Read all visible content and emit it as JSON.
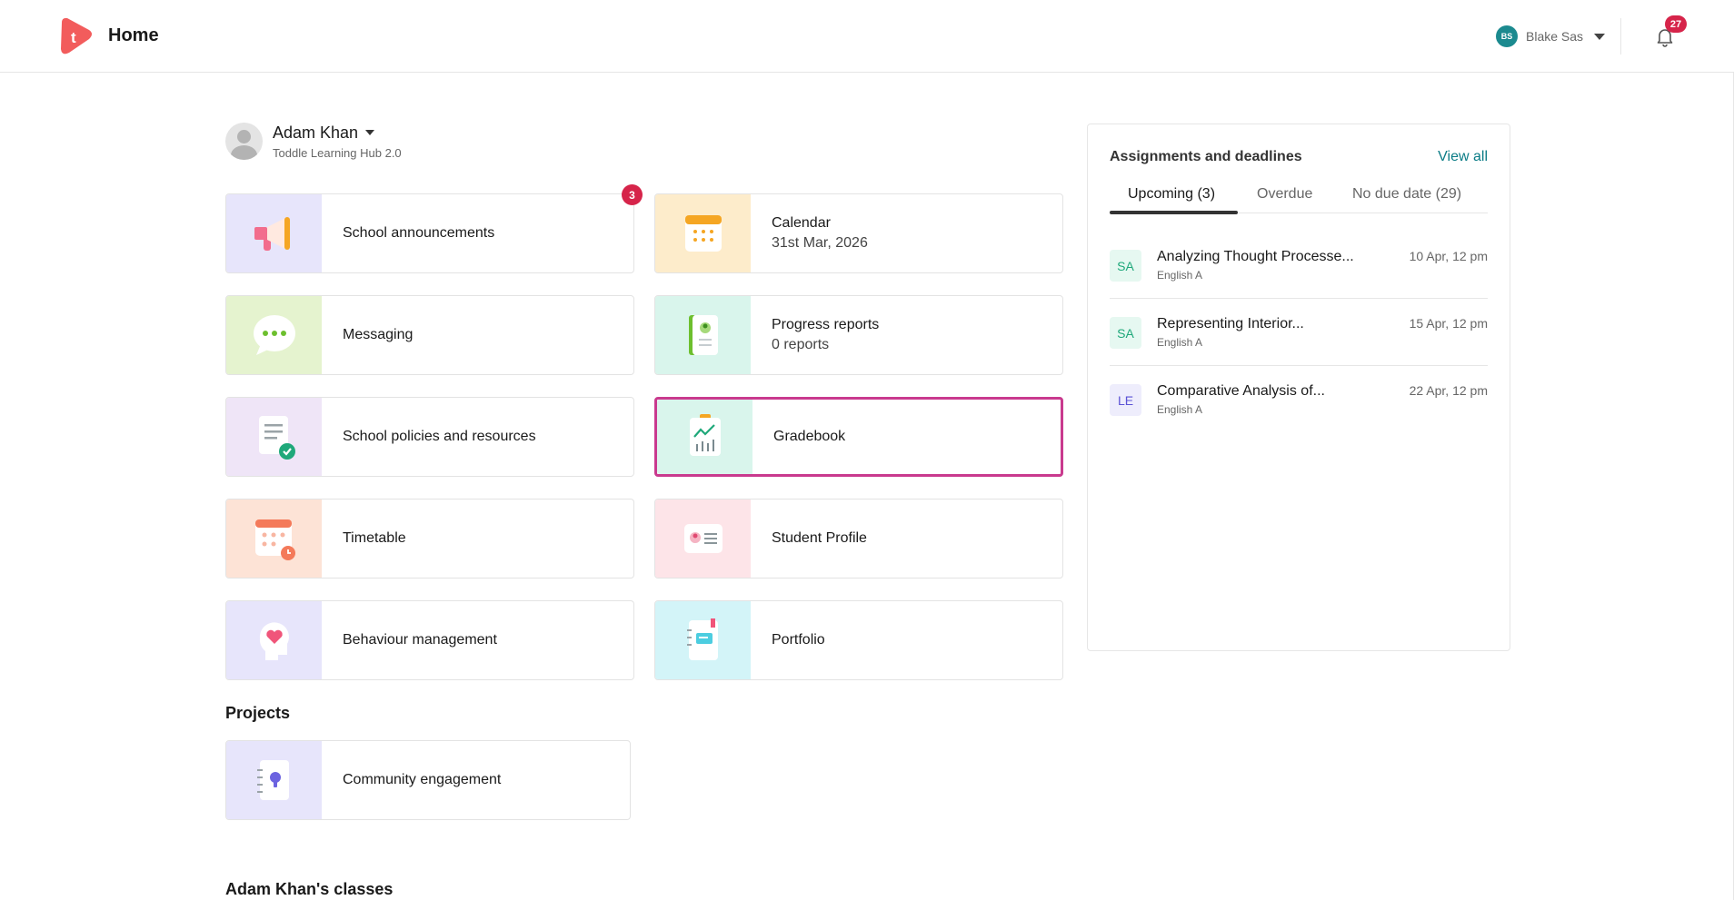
{
  "header": {
    "title": "Home",
    "user": {
      "initials": "BS",
      "name": "Blake Sas"
    },
    "notifications_count": "27"
  },
  "profile": {
    "name": "Adam Khan",
    "subtitle": "Toddle Learning Hub 2.0"
  },
  "tiles": [
    {
      "key": "announcements",
      "title": "School announcements",
      "subtitle": "",
      "icon": "megaphone-icon",
      "badge": "3"
    },
    {
      "key": "calendar",
      "title": "Calendar",
      "subtitle": "31st Mar, 2026",
      "icon": "calendar-icon"
    },
    {
      "key": "messaging",
      "title": "Messaging",
      "subtitle": "",
      "icon": "chat-bubble-icon"
    },
    {
      "key": "progress",
      "title": "Progress reports",
      "subtitle": "0 reports",
      "icon": "report-book-icon"
    },
    {
      "key": "policies",
      "title": "School policies and resources",
      "subtitle": "",
      "icon": "policy-document-icon"
    },
    {
      "key": "gradebook",
      "title": "Gradebook",
      "subtitle": "",
      "icon": "chart-document-icon",
      "selected": true
    },
    {
      "key": "timetable",
      "title": "Timetable",
      "subtitle": "",
      "icon": "timetable-icon"
    },
    {
      "key": "student-profile",
      "title": "Student Profile",
      "subtitle": "",
      "icon": "id-card-icon"
    },
    {
      "key": "behaviour",
      "title": "Behaviour management",
      "subtitle": "",
      "icon": "head-heart-icon"
    },
    {
      "key": "portfolio",
      "title": "Portfolio",
      "subtitle": "",
      "icon": "notebook-icon"
    }
  ],
  "projects": {
    "title": "Projects",
    "items": [
      {
        "title": "Community engagement",
        "icon": "lightbulb-notebook-icon"
      }
    ]
  },
  "classes": {
    "title": "Adam Khan's classes"
  },
  "assignments": {
    "title": "Assignments and deadlines",
    "view_all": "View all",
    "tabs": [
      {
        "label": "Upcoming (3)",
        "active": true
      },
      {
        "label": "Overdue",
        "active": false
      },
      {
        "label": "No due date (29)",
        "active": false
      }
    ],
    "items": [
      {
        "initials": "SA",
        "title": "Analyzing Thought Processe...",
        "course": "English A",
        "due": "10 Apr, 12 pm"
      },
      {
        "initials": "SA",
        "title": "Representing Interior...",
        "course": "English A",
        "due": "15 Apr, 12 pm"
      },
      {
        "initials": "LE",
        "title": "Comparative Analysis of...",
        "course": "English A",
        "due": "22 Apr, 12 pm"
      }
    ]
  },
  "colors": {
    "accent": "#0b7c86",
    "badge": "#d6244a",
    "selection": "#c93a8e",
    "brand": "#f25c5c"
  }
}
